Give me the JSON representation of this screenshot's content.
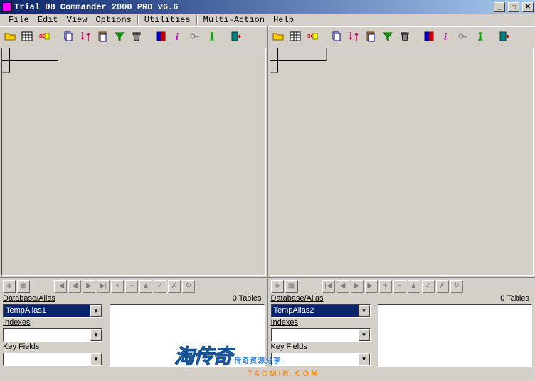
{
  "window": {
    "title": "Trial DB Commander 2000 PRO v6.6"
  },
  "menu": {
    "file": "File",
    "edit": "Edit",
    "view": "View",
    "options": "Options",
    "utilities": "Utilities",
    "multi": "Multi-Action",
    "help": "Help"
  },
  "toolbar_icons": [
    "open-folder-icon",
    "grid-table-icon",
    "sql-query-icon",
    "blank1-icon",
    "copy-icon",
    "sort-icon",
    "paste-icon",
    "filter-icon",
    "trash-icon",
    "restructure-icon",
    "info-icon",
    "key-icon",
    "run-green-icon",
    "blank2-icon",
    "exit-icon"
  ],
  "nav": {
    "first": "|◀",
    "prev": "◀",
    "next": "▶",
    "last": "▶|",
    "insert": "+",
    "delete": "−",
    "edit": "▲",
    "post": "✓",
    "cancel": "✗",
    "refresh": "↻"
  },
  "left": {
    "db_label": "Database/Alias",
    "db_value": "TempAlias1",
    "idx_label": "Indexes",
    "idx_value": "",
    "key_label": "Key Fields",
    "key_value": "",
    "tables_label": "0 Tables"
  },
  "right": {
    "db_label": "Database/Alias",
    "db_value": "TempAlias2",
    "idx_label": "Indexes",
    "idx_value": "",
    "key_label": "Key Fields",
    "key_value": "",
    "tables_label": "0 Tables"
  },
  "watermark": {
    "big": "淘传奇",
    "sub": "传奇资源分享",
    "url": "TAOMIR.COM"
  }
}
